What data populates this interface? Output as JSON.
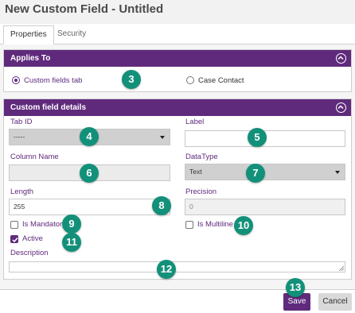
{
  "window": {
    "title": "New Custom Field - Untitled"
  },
  "tabs": [
    {
      "label": "Properties",
      "active": true
    },
    {
      "label": "Security",
      "active": false
    }
  ],
  "applies_to": {
    "header": "Applies To",
    "options": [
      {
        "label": "Custom fields tab",
        "selected": true
      },
      {
        "label": "Case Contact",
        "selected": false
      }
    ]
  },
  "details": {
    "header": "Custom field details",
    "tab_id": {
      "label": "Tab ID",
      "value": "-----"
    },
    "label_field": {
      "label": "Label",
      "value": ""
    },
    "column_name": {
      "label": "Column Name",
      "value": ""
    },
    "datatype": {
      "label": "DataType",
      "value": "Text"
    },
    "length": {
      "label": "Length",
      "value": "255"
    },
    "precision": {
      "label": "Precision",
      "value": "0"
    },
    "is_mandatory": {
      "label": "Is Mandatory",
      "checked": false
    },
    "is_multiline": {
      "label": "Is Multiline",
      "checked": false
    },
    "active": {
      "label": "Active",
      "checked": true
    },
    "description": {
      "label": "Description",
      "value": ""
    }
  },
  "callouts": [
    "3",
    "4",
    "5",
    "6",
    "7",
    "8",
    "9",
    "10",
    "11",
    "12",
    "13"
  ],
  "footer": {
    "save_label": "Save",
    "cancel_label": "Cancel"
  },
  "colors": {
    "accent": "#5f2a7c",
    "callout": "#13907a"
  }
}
